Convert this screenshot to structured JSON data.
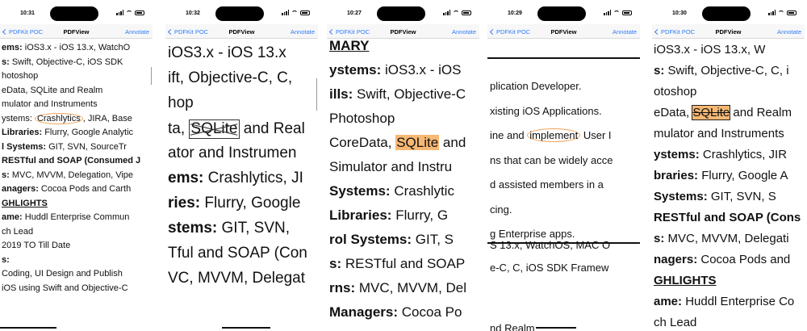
{
  "nav": {
    "back_label": "PDFKit POC",
    "title": "PDFView",
    "action_label": "Annotate"
  },
  "phones": [
    {
      "time": "10:31",
      "lines": [
        {
          "t": "ems: iOS3.x - iOS 13.x, WatchO"
        },
        {
          "t": "s: Swift, Objective-C, iOS SDK"
        },
        {
          "t": "hotoshop"
        },
        {
          "t": "eData, SQLite and Realm"
        },
        {
          "t": "mulator and Instruments"
        },
        {
          "p1": "ystems: ",
          "mark": "Crashlytics",
          "p2": ", JIRA, Base"
        },
        {
          "t": "Libraries: Flurry, Google Analytic"
        },
        {
          "t": "l Systems:  GIT, SVN, SourceTr"
        },
        {
          "t": "RESTful and SOAP (Consumed J"
        },
        {
          "t": "s: MVC, MVVM, Delegation, Vipe"
        },
        {
          "t": "anagers: Cocoa Pods and Carth"
        },
        {
          "t": "GHLIGHTS"
        },
        {
          "t": "ame: Huddl Enterprise Commun"
        },
        {
          "t": "ch Lead"
        },
        {
          "t": "2019 TO Till Date"
        },
        {
          "t": "s:"
        },
        {
          "t": "Coding, UI Design and Publish"
        },
        {
          "t": "iOS using Swift and Objective-C"
        }
      ]
    },
    {
      "time": "10:32",
      "lines": [
        {
          "t": "iOS3.x - iOS 13.x"
        },
        {
          "t": "ift, Objective-C, C,"
        },
        {
          "t": "hop"
        },
        {
          "p1": "ta, ",
          "mark": "SQLite",
          "p2": " and Real"
        },
        {
          "t": "ator and Instrumen"
        },
        {
          "t": "ems: Crashlytics, JI"
        },
        {
          "t": "ries: Flurry, Google"
        },
        {
          "t": "stems:  GIT, SVN,"
        },
        {
          "t": "Tful and SOAP (Con"
        },
        {
          "t": "VC, MVVM, Delegat"
        }
      ]
    },
    {
      "time": "10:27",
      "lines": [
        {
          "t": "MARY"
        },
        {
          "t": "ystems: iOS3.x - iOS"
        },
        {
          "t": "ills: Swift, Objective-C"
        },
        {
          "t": "Photoshop"
        },
        {
          "p1": "CoreData, ",
          "mark": "SQLite",
          "p2": " and"
        },
        {
          "t": "Simulator and Instru"
        },
        {
          "t": "Systems: Crashlytic"
        },
        {
          "t": "Libraries: Flurry, G"
        },
        {
          "t": "rol Systems:  GIT, S"
        },
        {
          "t": "s: RESTful and SOAP"
        },
        {
          "t": "rns: MVC, MVVM, Del"
        },
        {
          "t": "Managers: Cocoa Po"
        }
      ]
    },
    {
      "time": "10:29",
      "lines": [
        {
          "t": "plication Developer."
        },
        {
          "t": "xisting iOS Applications."
        },
        {
          "p1": "ine and ",
          "mark": "implement",
          "p2": " User I"
        },
        {
          "t": "ns that can be widely acce"
        },
        {
          "t": "d assisted members in a"
        },
        {
          "t": "cing."
        },
        {
          "t": "g Enterprise apps."
        },
        {
          "t": "S 13.x, WatchOS, MAC O"
        },
        {
          "t": "e-C, C, iOS SDK Framew"
        },
        {
          "t": "nd Realm"
        }
      ]
    },
    {
      "time": "10:30",
      "lines": [
        {
          "t": "iOS3.x - iOS 13.x, W"
        },
        {
          "t": "s: Swift, Objective-C, C, i"
        },
        {
          "t": "otoshop"
        },
        {
          "p1": "eData, ",
          "mark": "SQLite",
          "p2": " and Realm"
        },
        {
          "t": "mulator and Instruments"
        },
        {
          "t": "ystems: Crashlytics, JIR"
        },
        {
          "t": "braries: Flurry, Google A"
        },
        {
          "t": " Systems:  GIT, SVN, S"
        },
        {
          "t": "RESTful and SOAP (Cons"
        },
        {
          "t": "s: MVC, MVVM, Delegati"
        },
        {
          "t": "nagers: Cocoa Pods and"
        },
        {
          "t": "GHLIGHTS"
        },
        {
          "t": "ame: Huddl Enterprise Co"
        },
        {
          "t": "ch Lead"
        }
      ]
    }
  ]
}
